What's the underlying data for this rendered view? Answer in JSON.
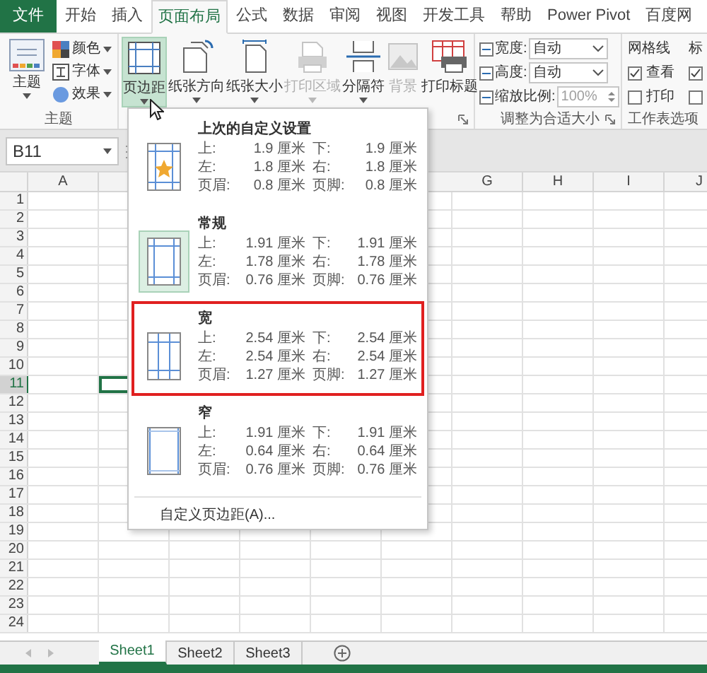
{
  "ribbon_tabs": [
    {
      "label": "文件",
      "kind": "file",
      "selected": false
    },
    {
      "label": "开始",
      "kind": "tab",
      "selected": false
    },
    {
      "label": "插入",
      "kind": "tab",
      "selected": false
    },
    {
      "label": "页面布局",
      "kind": "tab",
      "selected": true
    },
    {
      "label": "公式",
      "kind": "tab",
      "selected": false
    },
    {
      "label": "数据",
      "kind": "tab",
      "selected": false
    },
    {
      "label": "审阅",
      "kind": "tab",
      "selected": false
    },
    {
      "label": "视图",
      "kind": "tab",
      "selected": false
    },
    {
      "label": "开发工具",
      "kind": "tab",
      "selected": false
    },
    {
      "label": "帮助",
      "kind": "tab",
      "selected": false
    },
    {
      "label": "Power Pivot",
      "kind": "tab",
      "selected": false
    },
    {
      "label": "百度网",
      "kind": "tab",
      "selected": false
    }
  ],
  "theme_group": {
    "label": "主题",
    "main_button": "主题",
    "small_buttons": [
      "颜色",
      "字体",
      "效果"
    ]
  },
  "page_setup_buttons": [
    {
      "label": "页边距",
      "selected": true,
      "disabled": false,
      "dropdown": true
    },
    {
      "label": "纸张方向",
      "selected": false,
      "disabled": false,
      "dropdown": true
    },
    {
      "label": "纸张大小",
      "selected": false,
      "disabled": false,
      "dropdown": true
    },
    {
      "label": "打印区域",
      "selected": false,
      "disabled": true,
      "dropdown": true
    },
    {
      "label": "分隔符",
      "selected": false,
      "disabled": false,
      "dropdown": true
    },
    {
      "label": "背景",
      "selected": false,
      "disabled": true,
      "dropdown": false
    },
    {
      "label": "打印标题",
      "selected": false,
      "disabled": false,
      "dropdown": false
    }
  ],
  "scale_group": {
    "label": "调整为合适大小",
    "rows": [
      {
        "label": "宽度:",
        "value": "自动",
        "kind": "select",
        "disabled": false
      },
      {
        "label": "高度:",
        "value": "自动",
        "kind": "select",
        "disabled": false
      },
      {
        "label": "缩放比例:",
        "value": "100%",
        "kind": "spin",
        "disabled": true
      }
    ]
  },
  "sheet_options_group": {
    "label": "工作表选项",
    "columns": [
      {
        "title": "网格线",
        "options": [
          {
            "label": "查看",
            "checked": true
          },
          {
            "label": "打印",
            "checked": false
          }
        ]
      },
      {
        "title": "标",
        "options": [
          {
            "checked": true
          },
          {
            "checked": false
          }
        ]
      }
    ]
  },
  "name_box": "B11",
  "columns": [
    "A",
    "G",
    "H",
    "I",
    "J"
  ],
  "rows": [
    {
      "label": "1",
      "selected": false
    },
    {
      "label": "2",
      "selected": false
    },
    {
      "label": "3",
      "selected": false
    },
    {
      "label": "4",
      "selected": false
    },
    {
      "label": "5",
      "selected": false
    },
    {
      "label": "6",
      "selected": false
    },
    {
      "label": "7",
      "selected": false
    },
    {
      "label": "8",
      "selected": false
    },
    {
      "label": "9",
      "selected": false
    },
    {
      "label": "10",
      "selected": false
    },
    {
      "label": "11",
      "selected": true
    },
    {
      "label": "12",
      "selected": false
    },
    {
      "label": "13",
      "selected": false
    },
    {
      "label": "14",
      "selected": false
    },
    {
      "label": "15",
      "selected": false
    },
    {
      "label": "16",
      "selected": false
    },
    {
      "label": "17",
      "selected": false
    },
    {
      "label": "18",
      "selected": false
    },
    {
      "label": "19",
      "selected": false
    },
    {
      "label": "20",
      "selected": false
    },
    {
      "label": "21",
      "selected": false
    },
    {
      "label": "22",
      "selected": false
    },
    {
      "label": "23",
      "selected": false
    },
    {
      "label": "24",
      "selected": false
    }
  ],
  "margins_menu": {
    "items": [
      {
        "title": "上次的自定义设置",
        "kind": "custom",
        "selected": false,
        "highlighted": false,
        "values": [
          [
            "上:",
            "1.9 厘米",
            "下:",
            "1.9 厘米"
          ],
          [
            "左:",
            "1.8 厘米",
            "右:",
            "1.8 厘米"
          ],
          [
            "页眉:",
            "0.8 厘米",
            "页脚:",
            "0.8 厘米"
          ]
        ]
      },
      {
        "title": "常规",
        "kind": "normal",
        "selected": true,
        "highlighted": false,
        "values": [
          [
            "上:",
            "1.91 厘米",
            "下:",
            "1.91 厘米"
          ],
          [
            "左:",
            "1.78 厘米",
            "右:",
            "1.78 厘米"
          ],
          [
            "页眉:",
            "0.76 厘米",
            "页脚:",
            "0.76 厘米"
          ]
        ]
      },
      {
        "title": "宽",
        "kind": "wide",
        "selected": false,
        "highlighted": true,
        "values": [
          [
            "上:",
            "2.54 厘米",
            "下:",
            "2.54 厘米"
          ],
          [
            "左:",
            "2.54 厘米",
            "右:",
            "2.54 厘米"
          ],
          [
            "页眉:",
            "1.27 厘米",
            "页脚:",
            "1.27 厘米"
          ]
        ]
      },
      {
        "title": "窄",
        "kind": "narrow",
        "selected": false,
        "highlighted": false,
        "values": [
          [
            "上:",
            "1.91 厘米",
            "下:",
            "1.91 厘米"
          ],
          [
            "左:",
            "0.64 厘米",
            "右:",
            "0.64 厘米"
          ],
          [
            "页眉:",
            "0.76 厘米",
            "页脚:",
            "0.76 厘米"
          ]
        ]
      }
    ],
    "footer": "自定义页边距(A)..."
  },
  "sheet_tabs": [
    {
      "label": "Sheet1",
      "selected": true
    },
    {
      "label": "Sheet2",
      "selected": false
    },
    {
      "label": "Sheet3",
      "selected": false
    }
  ]
}
